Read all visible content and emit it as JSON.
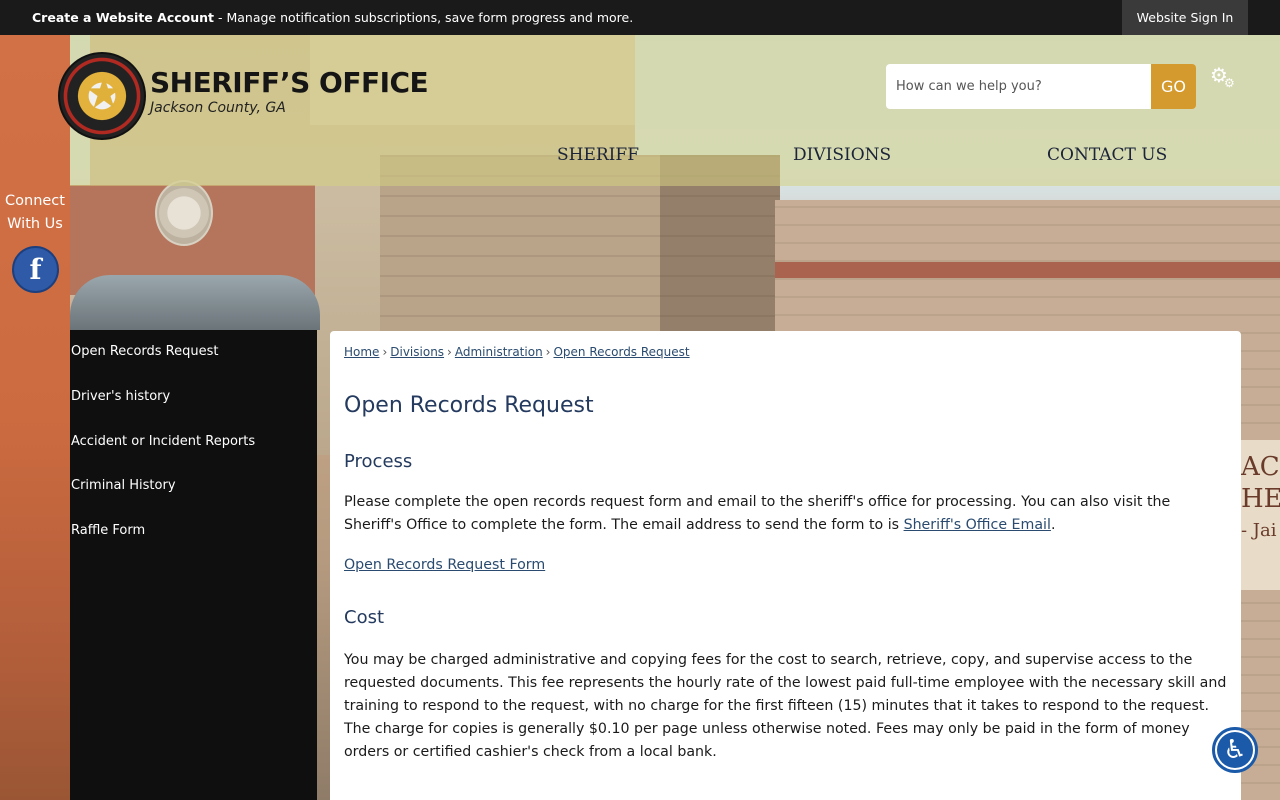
{
  "topbar": {
    "account_bold": "Create a Website Account",
    "account_rest": " - Manage notification subscriptions, save form progress and more.",
    "signin": "Website Sign In"
  },
  "logo": {
    "title": "SHERIFF’S OFFICE",
    "subtitle": "Jackson County, GA"
  },
  "search": {
    "placeholder": "How can we help you?",
    "go": "GO",
    "settings_icon": "gear-icon"
  },
  "nav": [
    "SHERIFF",
    "DIVISIONS",
    "CONTACT US"
  ],
  "connect": {
    "line1": "Connect",
    "line2": "With Us",
    "facebook_glyph": "f"
  },
  "sidebar": {
    "items": [
      "Open Records Request",
      "Driver's history",
      "Accident or Incident Reports",
      "Criminal History",
      "Raffle Form"
    ]
  },
  "breadcrumb": [
    "Home",
    "Divisions",
    "Administration",
    "Open Records Request"
  ],
  "main": {
    "title": "Open Records Request",
    "process_heading": "Process",
    "process_text": "Please complete the open records request form and email to the sheriff's office for processing. You can also visit the Sheriff's Office to complete the form. The email address to send the form to is ",
    "process_link": "Sheriff's Office Email",
    "process_end": ".",
    "form_link": "Open Records Request Form",
    "cost_heading": "Cost",
    "cost_text": "You may be charged administrative and copying fees for the cost to search, retrieve, copy, and supervise access to the requested documents. This fee represents the hourly rate of the lowest paid full-time employee with the necessary skill and training to respond to the request, with no charge for the first fifteen (15) minutes that it takes to respond to the request. The charge for copies is generally $0.10 per page unless otherwise noted. Fees may only be paid in the form of money orders or certified cashier's check from a local bank."
  },
  "colors": {
    "accent": "#d49a2e",
    "heading": "#243a5e",
    "link": "#2a4b6f",
    "facebook": "#2e5aa7"
  }
}
